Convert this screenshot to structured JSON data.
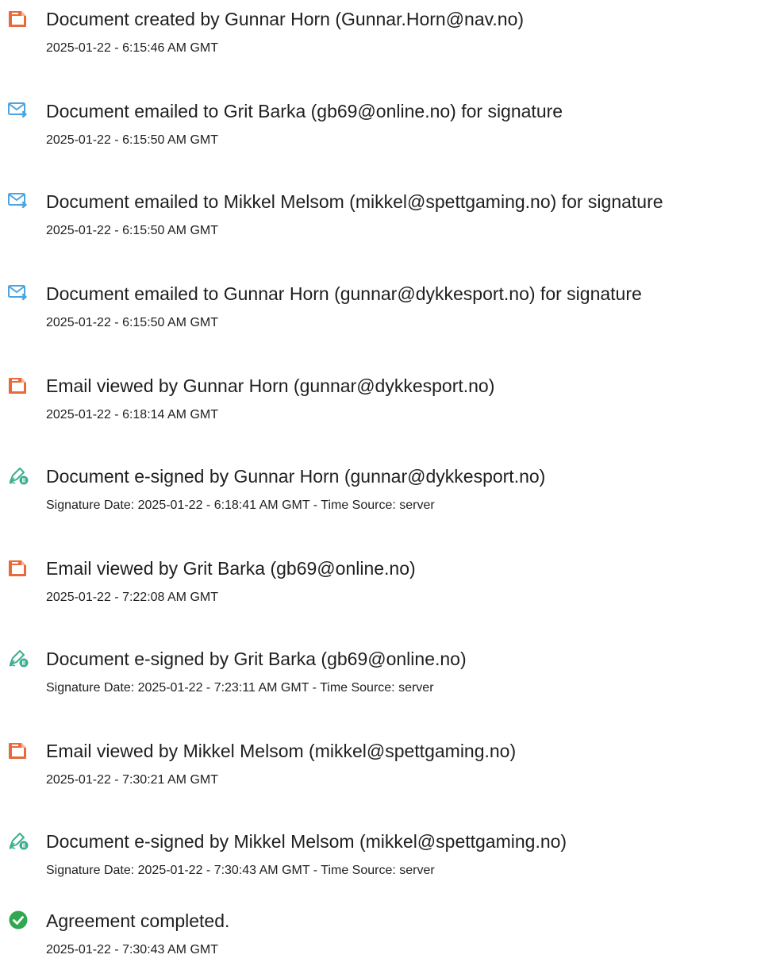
{
  "events": [
    {
      "icon": "document-created-icon",
      "title": "Document created by Gunnar Horn (Gunnar.Horn@nav.no)",
      "detail": "2025-01-22 - 6:15:46 AM GMT"
    },
    {
      "icon": "email-sent-icon",
      "title": "Document emailed to Grit Barka (gb69@online.no) for signature",
      "detail": "2025-01-22 - 6:15:50 AM GMT"
    },
    {
      "icon": "email-sent-icon",
      "title": "Document emailed to Mikkel Melsom (mikkel@spettgaming.no) for signature",
      "detail": "2025-01-22 - 6:15:50 AM GMT"
    },
    {
      "icon": "email-sent-icon",
      "title": "Document emailed to Gunnar Horn (gunnar@dykkesport.no) for signature",
      "detail": "2025-01-22 - 6:15:50 AM GMT"
    },
    {
      "icon": "document-viewed-icon",
      "title": "Email viewed by Gunnar Horn (gunnar@dykkesport.no)",
      "detail": "2025-01-22 - 6:18:14 AM GMT"
    },
    {
      "icon": "e-sign-pen-icon",
      "title": "Document e-signed by Gunnar Horn (gunnar@dykkesport.no)",
      "detail": "Signature Date: 2025-01-22 - 6:18:41 AM GMT - Time Source: server"
    },
    {
      "icon": "document-viewed-icon",
      "title": "Email viewed by Grit Barka (gb69@online.no)",
      "detail": "2025-01-22 - 7:22:08 AM GMT"
    },
    {
      "icon": "e-sign-pen-icon",
      "title": "Document e-signed by Grit Barka (gb69@online.no)",
      "detail": "Signature Date: 2025-01-22 - 7:23:11 AM GMT - Time Source: server"
    },
    {
      "icon": "document-viewed-icon",
      "title": "Email viewed by Mikkel Melsom (mikkel@spettgaming.no)",
      "detail": "2025-01-22 - 7:30:21 AM GMT"
    },
    {
      "icon": "e-sign-pen-icon",
      "title": "Document e-signed by Mikkel Melsom (mikkel@spettgaming.no)",
      "detail": "Signature Date: 2025-01-22 - 7:30:43 AM GMT - Time Source: server"
    },
    {
      "icon": "agreement-completed-check-icon",
      "title": "Agreement completed.",
      "detail": "2025-01-22 - 7:30:43 AM GMT"
    }
  ],
  "colors": {
    "doc_icon": "#e86a3a",
    "mail_icon": "#4da3df",
    "sign_icon": "#3cae8f",
    "check_icon": "#2fa84f",
    "text": "#1f1f1f"
  }
}
